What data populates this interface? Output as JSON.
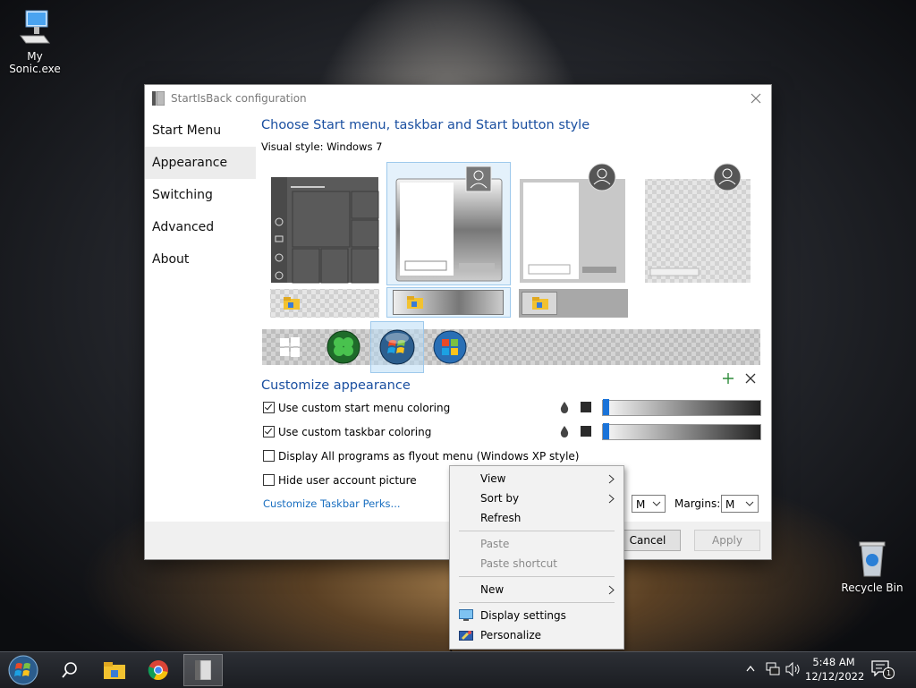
{
  "desktop": {
    "icons": [
      {
        "label": "My Sonic.exe",
        "icon": "computer-icon"
      },
      {
        "label": "Recycle Bin",
        "icon": "recycle-bin-icon"
      }
    ]
  },
  "window": {
    "title": "StartIsBack configuration",
    "nav": [
      "Start Menu",
      "Appearance",
      "Switching",
      "Advanced",
      "About"
    ],
    "active_nav": "Appearance",
    "heading": "Choose Start menu, taskbar and Start button style",
    "visual_style_label": "Visual style:",
    "visual_style_value": "Windows 7",
    "customize_heading": "Customize appearance",
    "options": [
      {
        "label": "Use custom start menu coloring",
        "checked": true
      },
      {
        "label": "Use custom taskbar coloring",
        "checked": true
      },
      {
        "label": "Display All programs as flyout menu (Windows XP style)",
        "checked": false
      },
      {
        "label": "Hide user account picture",
        "checked": false
      }
    ],
    "link": "Customize Taskbar Perks...",
    "size_select": "M",
    "margins_label": "Margins:",
    "margins_select": "M",
    "buttons": {
      "cancel": "Cancel",
      "apply": "Apply"
    }
  },
  "context_menu": {
    "items": [
      {
        "label": "View",
        "submenu": true,
        "enabled": true
      },
      {
        "label": "Sort by",
        "submenu": true,
        "enabled": true
      },
      {
        "label": "Refresh",
        "submenu": false,
        "enabled": true
      },
      {
        "label": "Paste",
        "submenu": false,
        "enabled": false
      },
      {
        "label": "Paste shortcut",
        "submenu": false,
        "enabled": false
      },
      {
        "label": "New",
        "submenu": true,
        "enabled": true
      },
      {
        "label": "Display settings",
        "submenu": false,
        "enabled": true,
        "icon": "display-icon"
      },
      {
        "label": "Personalize",
        "submenu": false,
        "enabled": true,
        "icon": "personalize-icon"
      }
    ]
  },
  "taskbar": {
    "time": "5:48 AM",
    "date": "12/12/2022",
    "notification_count": "1",
    "accent": "#1a73d9"
  }
}
